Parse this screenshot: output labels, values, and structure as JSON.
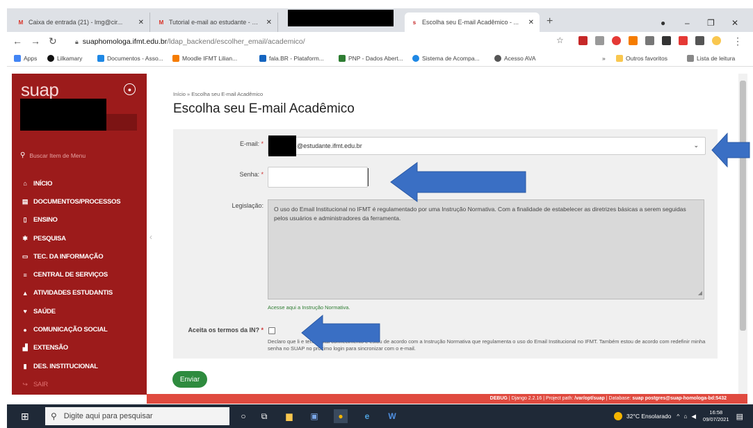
{
  "browser": {
    "tabs": [
      {
        "label": "Caixa de entrada (21) - lmg@cir..."
      },
      {
        "label": "Tutorial e-mail ao estudante - Ei..."
      },
      {
        "label": "Escolha seu E-mail Acadêmico - ..."
      }
    ],
    "new_tab": "+",
    "url_host": "suaphomologa.ifmt.edu.br",
    "url_path": "/ldap_backend/escolher_email/academico/",
    "bookmarks": [
      {
        "label": "Apps"
      },
      {
        "label": "Lilkamary"
      },
      {
        "label": "Documentos - Asso..."
      },
      {
        "label": "Moodle IFMT Lilian..."
      },
      {
        "label": "fala.BR - Plataform..."
      },
      {
        "label": "PNP - Dados Abert..."
      },
      {
        "label": "Sistema de Acompa..."
      },
      {
        "label": "Acesso AVA"
      },
      {
        "label": "Outros favoritos"
      },
      {
        "label": "Lista de leitura"
      }
    ],
    "bookmarks_more": "»"
  },
  "sidebar": {
    "logo": "suap",
    "search_placeholder": "Buscar Item de Menu",
    "items": [
      {
        "label": "INÍCIO",
        "icon": "home-icon"
      },
      {
        "label": "DOCUMENTOS/PROCESSOS",
        "icon": "document-icon"
      },
      {
        "label": "ENSINO",
        "icon": "book-icon"
      },
      {
        "label": "PESQUISA",
        "icon": "microscope-icon"
      },
      {
        "label": "TEC. DA INFORMAÇÃO",
        "icon": "monitor-icon"
      },
      {
        "label": "CENTRAL DE SERVIÇOS",
        "icon": "list-icon"
      },
      {
        "label": "ATIVIDADES ESTUDANTIS",
        "icon": "graduation-icon"
      },
      {
        "label": "SAÚDE",
        "icon": "heart-icon"
      },
      {
        "label": "COMUNICAÇÃO SOCIAL",
        "icon": "chat-icon"
      },
      {
        "label": "EXTENSÃO",
        "icon": "building-icon"
      },
      {
        "label": "DES. INSTITUCIONAL",
        "icon": "bar-chart-icon"
      },
      {
        "label": "SAIR",
        "icon": "exit-icon"
      }
    ]
  },
  "main": {
    "breadcrumb": "Início  »  Escolha seu E-mail Acadêmico",
    "title": "Escolha seu E-mail Acadêmico",
    "form": {
      "email_label": "E-mail:",
      "email_value": "@estudante.ifmt.edu.br",
      "password_label": "Senha:",
      "legislation_label": "Legislação:",
      "legislation_text": "O uso do Email Institucional no IFMT é regulamentado por uma Instrução Normativa. Com a finalidade de estabelecer as diretrizes básicas a serem seguidas pelos usuários e administradores da ferramenta.",
      "legislation_link": "Acesse aqui a Instrução Normativa.",
      "terms_label": "Aceita os termos da IN?",
      "terms_description": "Declaro que li e tenho total conhecimento e estou de acordo com a Instrução Normativa que regulamenta o uso do Email Institucional no IFMT. Também estou de acordo com redefinir minha senha no SUAP no próximo login para sincronizar com o e-mail.",
      "required_mark": "*",
      "submit_label": "Enviar"
    }
  },
  "debug": {
    "label": "DEBUG",
    "django": "Django 2.2.16",
    "path_label": "Project path:",
    "path_value": "/var/opt/suap",
    "db_label": "Database:",
    "db_value": "suap postgres@suap-homologa-bd:5432"
  },
  "taskbar": {
    "search_placeholder": "Digite aqui para pesquisar",
    "weather": "32°C  Ensolarado",
    "time": "16:58",
    "date": "09/07/2021"
  },
  "colors": {
    "sidebar": "#9c1b1b",
    "submit": "#2e8b3e",
    "debug": "#e04a3f",
    "arrow": "#3a6fc4"
  }
}
